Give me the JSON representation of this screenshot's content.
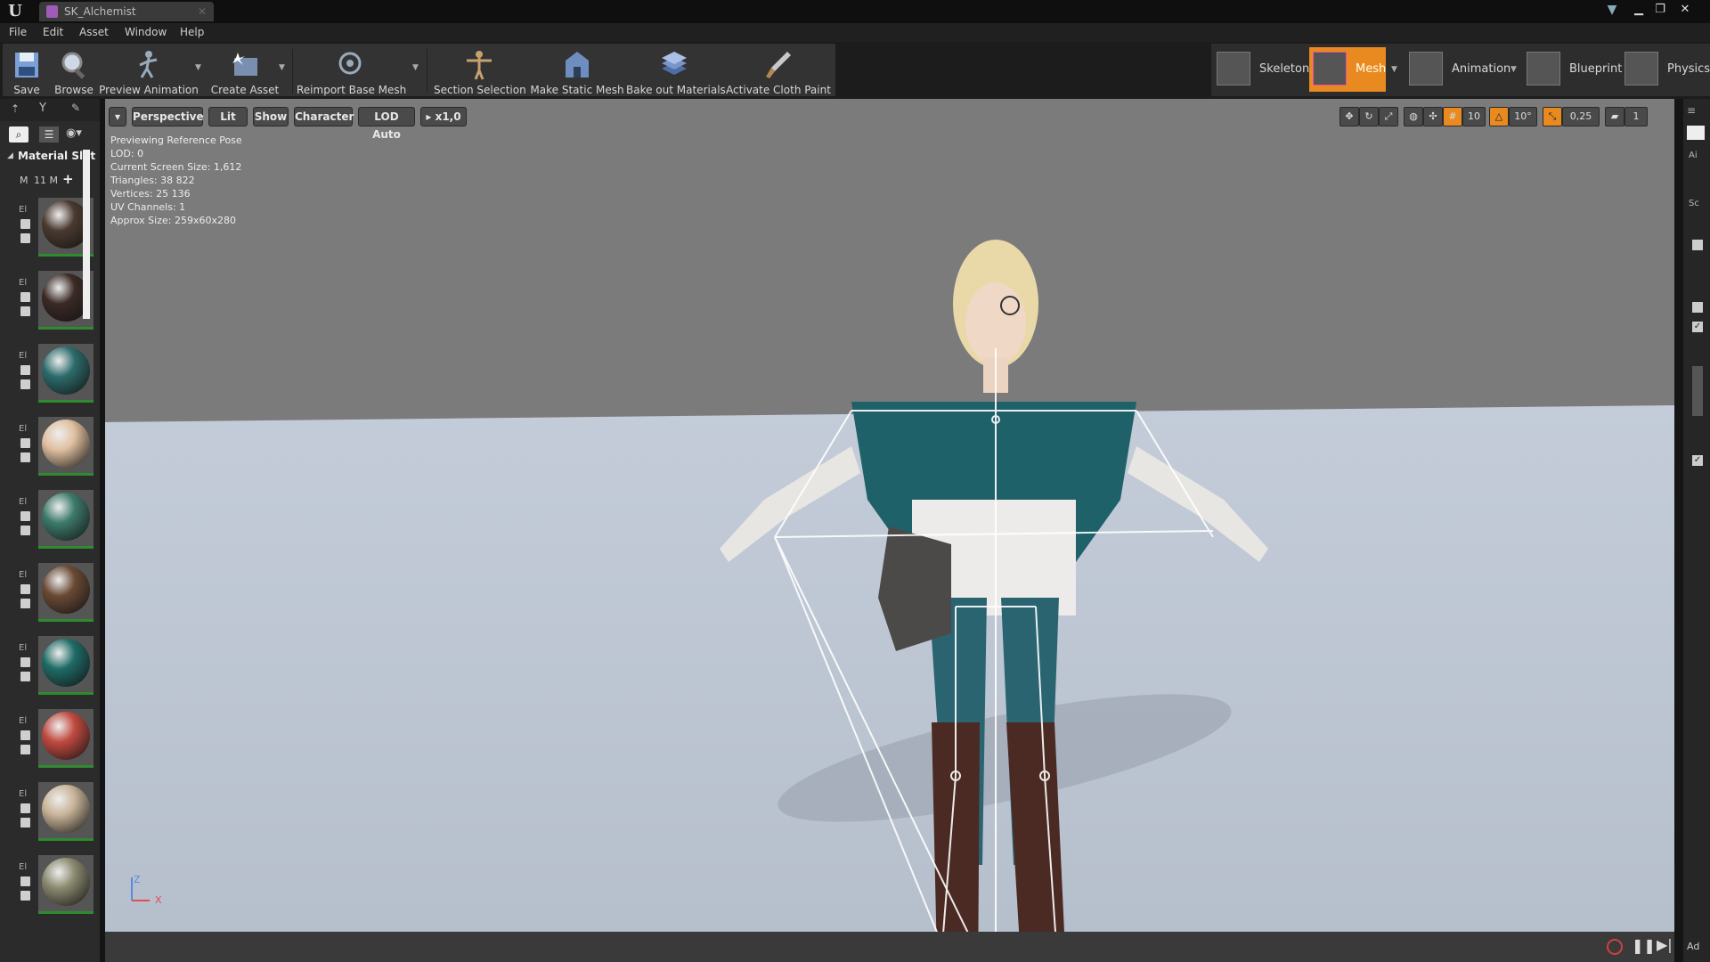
{
  "window": {
    "tab_title": "SK_Alchemist"
  },
  "menu": [
    "File",
    "Edit",
    "Asset",
    "Window",
    "Help"
  ],
  "toolbar": {
    "save": "Save",
    "browse": "Browse",
    "preview_animation": "Preview Animation",
    "create_asset": "Create Asset",
    "reimport_base_mesh": "Reimport Base Mesh",
    "section_selection": "Section Selection",
    "make_static_mesh": "Make Static Mesh",
    "bake_out_materials": "Bake out Materials",
    "activate_cloth_paint": "Activate Cloth Paint"
  },
  "modes": {
    "skeleton": "Skeleton",
    "mesh": "Mesh",
    "animation": "Animation",
    "blueprint": "Blueprint",
    "physics": "Physics"
  },
  "left_panel": {
    "header": "Material Slot",
    "count_prefix": "M",
    "count": "11 M",
    "element_label": "El",
    "materials": [
      {
        "color": "#4a3a30"
      },
      {
        "color": "#3a2a25"
      },
      {
        "color": "#2d6b6b"
      },
      {
        "color": "#e0c0a0"
      },
      {
        "color": "#3d7a6a"
      },
      {
        "color": "#6a4a35"
      },
      {
        "color": "#1f6b66"
      },
      {
        "color": "#c04a40"
      },
      {
        "color": "#c8b498"
      },
      {
        "color": "#8a8a70"
      }
    ]
  },
  "viewport": {
    "perspective": "Perspective",
    "lit": "Lit",
    "show": "Show",
    "character": "Character",
    "lod": "LOD Auto",
    "speed": "x1,0",
    "grid_snap": "10",
    "rotation_snap": "10°",
    "scale_snap": "0,25",
    "camera_speed": "1",
    "stats": [
      "Previewing Reference Pose",
      "LOD: 0",
      "Current Screen Size: 1,612",
      "Triangles: 38 822",
      "Vertices: 25 136",
      "UV Channels: 1",
      "Approx Size: 259x60x280"
    ],
    "axis_z": "Z",
    "axis_x": "X"
  },
  "right_panel": {
    "label_a": "Ai",
    "label_b": "Sc",
    "bottom_label": "Ad"
  }
}
